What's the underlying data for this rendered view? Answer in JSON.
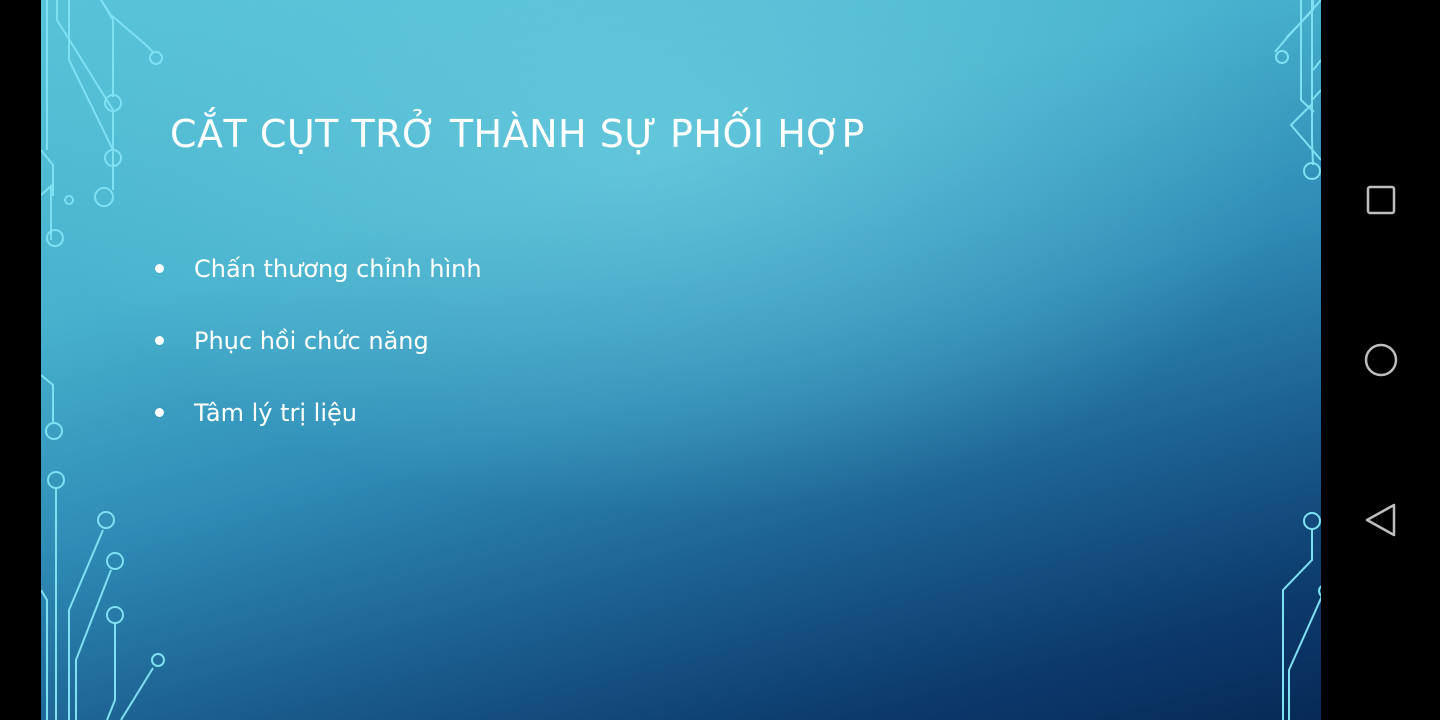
{
  "slide": {
    "title": "CẮT CỤT TRỞ THÀNH SỰ PHỐI HỢP",
    "bullets": [
      "Chấn thương chỉnh hình",
      "Phục hồi chức năng",
      "Tâm lý trị liệu"
    ],
    "colors": {
      "text": "#ffffff",
      "background_light": "#58c3d8",
      "background_dark": "#072a57",
      "circuit": "#7fe0f2"
    },
    "decorations": [
      "circuit-lines-left",
      "circuit-lines-right"
    ]
  },
  "navigation_bar": {
    "buttons": [
      {
        "name": "recents",
        "icon": "square-icon"
      },
      {
        "name": "home",
        "icon": "circle-icon"
      },
      {
        "name": "back",
        "icon": "triangle-back-icon"
      }
    ]
  }
}
